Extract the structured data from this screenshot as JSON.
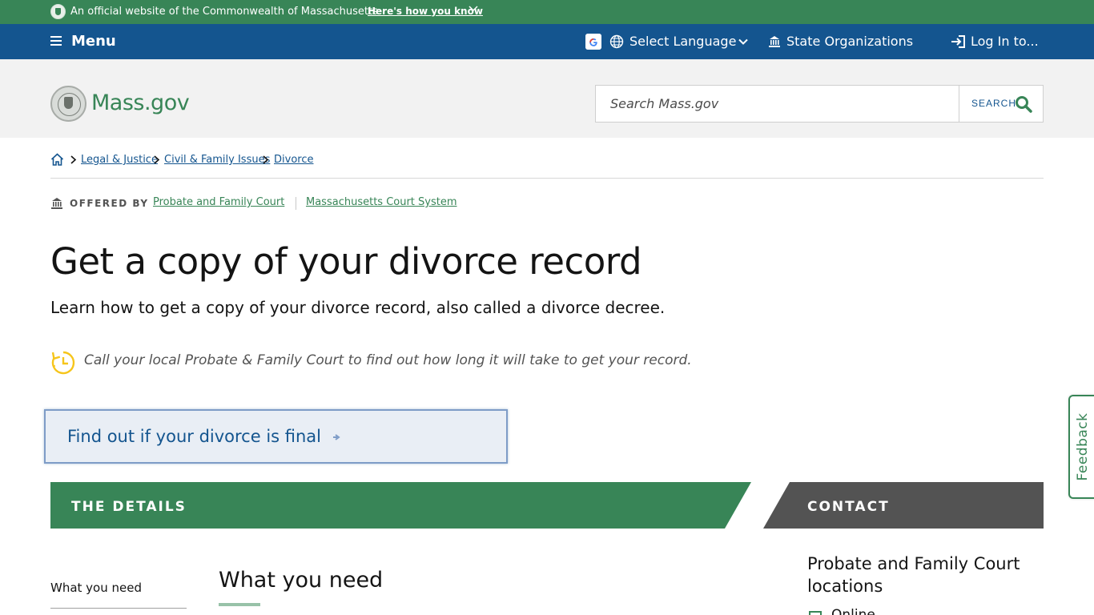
{
  "official_banner": {
    "text": "An official website of the Commonwealth of Massachusetts",
    "how_link": "Here's how you know"
  },
  "nav": {
    "menu_label": "Menu",
    "language_label": "Select Language",
    "state_orgs_label": "State Organizations",
    "login_label": "Log In to..."
  },
  "header": {
    "logo_text": "Mass.gov",
    "search_placeholder": "Search Mass.gov",
    "search_button": "SEARCH"
  },
  "breadcrumb": {
    "items": [
      "Legal & Justice",
      "Civil & Family Issues",
      "Divorce"
    ]
  },
  "offered_by": {
    "label": "OFFERED BY",
    "orgs": [
      "Probate and Family Court",
      "Massachusetts Court System"
    ]
  },
  "page": {
    "title": "Get a copy of your divorce record",
    "lede": "Learn how to get a copy of your divorce record, also called a divorce decree.",
    "time_note": "Call your local Probate & Family Court to find out how long it will take to get your record.",
    "cta_label": "Find out if your divorce is final"
  },
  "sections": {
    "details_label": "THE DETAILS",
    "contact_label": "CONTACT"
  },
  "details": {
    "toc_items": [
      "What you need"
    ],
    "heading": "What you need"
  },
  "contact": {
    "title": "Probate and Family Court locations",
    "first_item": "Online"
  },
  "feedback_label": "Feedback",
  "colors": {
    "green": "#388557",
    "blue": "#14558f",
    "gray_bar": "#535353",
    "header_bg": "#f2f2f2",
    "timer_yellow": "#f6c51b"
  }
}
